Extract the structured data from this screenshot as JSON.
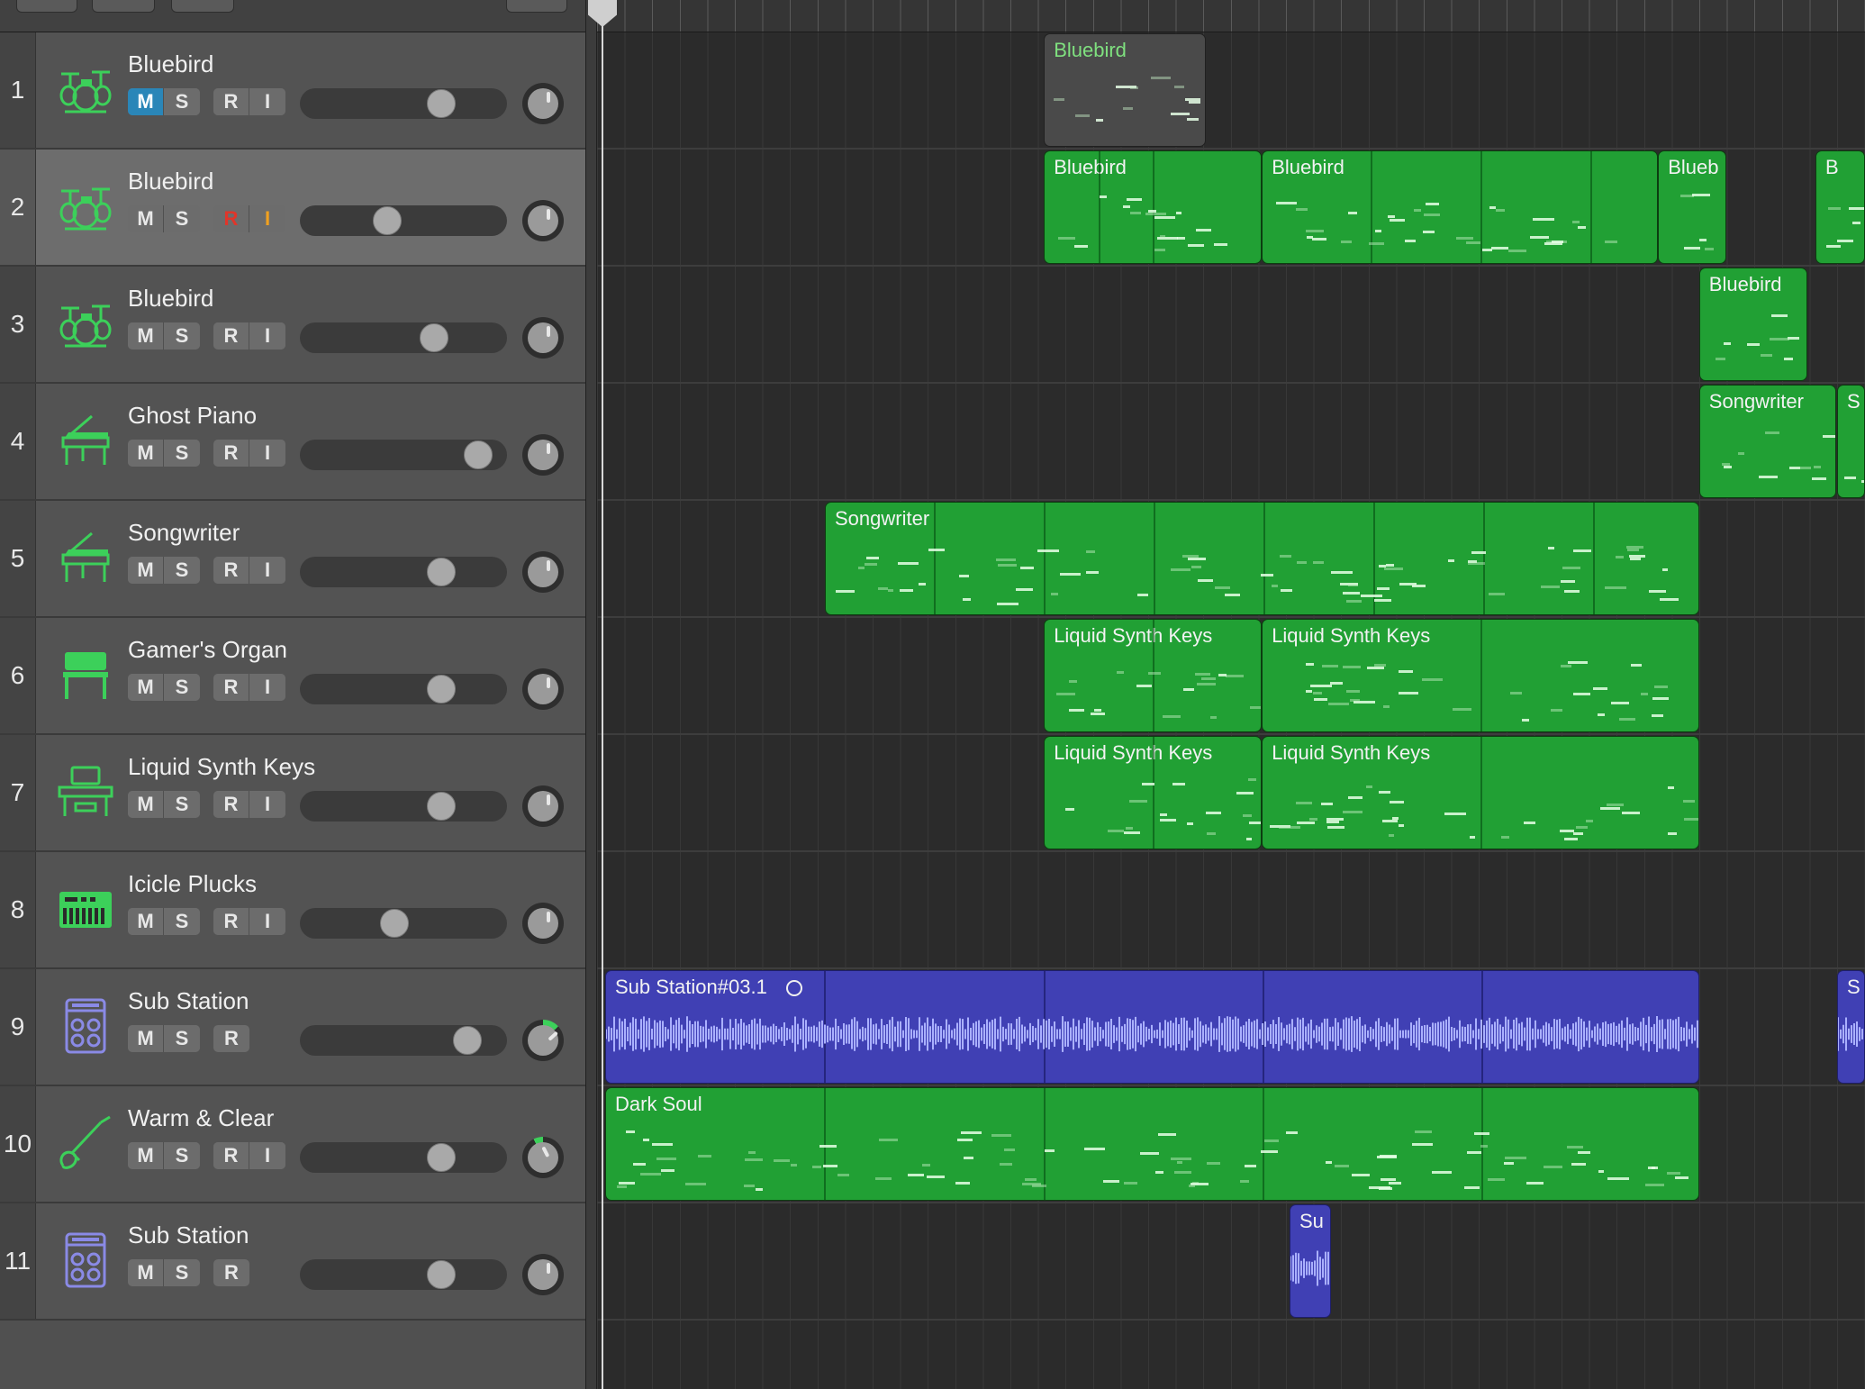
{
  "tracks": [
    {
      "num": "1",
      "name": "Bluebird",
      "icon": "drum-kit-icon",
      "mute": true,
      "solo": false,
      "rec": false,
      "input": false,
      "has_input": true,
      "volume": 0.71,
      "pan_color": "#e8e8e8",
      "pan": 0
    },
    {
      "num": "2",
      "name": "Bluebird",
      "icon": "drum-kit-icon",
      "mute": false,
      "solo": false,
      "rec": true,
      "input": true,
      "has_input": true,
      "volume": 0.41,
      "pan_color": "#e8e8e8",
      "pan": 0,
      "selected": true
    },
    {
      "num": "3",
      "name": "Bluebird",
      "icon": "drum-kit-icon",
      "mute": false,
      "solo": false,
      "rec": false,
      "input": false,
      "has_input": true,
      "volume": 0.67,
      "pan_color": "#e8e8e8",
      "pan": 0
    },
    {
      "num": "4",
      "name": "Ghost Piano",
      "icon": "grand-piano-icon",
      "mute": false,
      "solo": false,
      "rec": false,
      "input": false,
      "has_input": true,
      "volume": 0.92,
      "pan_color": "#e8e8e8",
      "pan": 0
    },
    {
      "num": "5",
      "name": "Songwriter",
      "icon": "grand-piano-icon",
      "mute": false,
      "solo": false,
      "rec": false,
      "input": false,
      "has_input": true,
      "volume": 0.71,
      "pan_color": "#e8e8e8",
      "pan": 0
    },
    {
      "num": "6",
      "name": "Gamer's Organ",
      "icon": "organ-icon",
      "mute": false,
      "solo": false,
      "rec": false,
      "input": false,
      "has_input": true,
      "volume": 0.71,
      "pan_color": "#e8e8e8",
      "pan": 0
    },
    {
      "num": "7",
      "name": "Liquid Synth Keys",
      "icon": "synth-workstation-icon",
      "mute": false,
      "solo": false,
      "rec": false,
      "input": false,
      "has_input": true,
      "volume": 0.71,
      "pan_color": "#e8e8e8",
      "pan": 0
    },
    {
      "num": "8",
      "name": "Icicle Plucks",
      "icon": "keyboard-synth-icon",
      "mute": false,
      "solo": false,
      "rec": false,
      "input": false,
      "has_input": true,
      "volume": 0.45,
      "pan_color": "#e8e8e8",
      "pan": 0
    },
    {
      "num": "9",
      "name": "Sub Station",
      "icon": "amp-cabinet-icon",
      "mute": false,
      "solo": false,
      "rec": false,
      "input": false,
      "has_input": false,
      "volume": 0.86,
      "pan_color": "#3cd05a",
      "pan": 0.35
    },
    {
      "num": "10",
      "name": "Warm & Clear",
      "icon": "bass-guitar-icon",
      "mute": false,
      "solo": false,
      "rec": false,
      "input": false,
      "has_input": true,
      "volume": 0.71,
      "pan_color": "#3cd05a",
      "pan": -0.2
    },
    {
      "num": "11",
      "name": "Sub Station",
      "icon": "amp-cabinet-icon",
      "mute": false,
      "solo": false,
      "rec": false,
      "input": false,
      "has_input": false,
      "volume": 0.71,
      "pan_color": "#e8e8e8",
      "pan": 0
    }
  ],
  "buttons": {
    "mute": "M",
    "solo": "S",
    "rec": "R",
    "input": "I"
  },
  "regions": [
    {
      "track": 1,
      "name": "Bluebird",
      "kind": "ghost",
      "start": 12.18,
      "len": 4.5,
      "seps": []
    },
    {
      "track": 2,
      "name": "Bluebird",
      "kind": "midi",
      "start": 12.18,
      "len": 6.05,
      "seps": [
        1.5,
        3.0
      ]
    },
    {
      "track": 2,
      "name": "Bluebird",
      "kind": "midi",
      "start": 18.23,
      "len": 11.0,
      "seps": [
        3.0,
        6.05,
        9.1
      ]
    },
    {
      "track": 2,
      "name": "Blueb",
      "kind": "midi",
      "start": 29.23,
      "len": 1.9,
      "seps": []
    },
    {
      "track": 2,
      "name": "B",
      "kind": "midi",
      "start": 33.6,
      "len": 2.0,
      "seps": []
    },
    {
      "track": 3,
      "name": "Bluebird",
      "kind": "midi",
      "start": 30.37,
      "len": 3.0,
      "seps": []
    },
    {
      "track": 4,
      "name": "Songwriter",
      "kind": "midi",
      "start": 30.37,
      "len": 3.8,
      "seps": []
    },
    {
      "track": 4,
      "name": "S",
      "kind": "midi",
      "start": 34.2,
      "len": 1.5,
      "seps": []
    },
    {
      "track": 5,
      "name": "Songwriter",
      "kind": "midi",
      "start": 6.1,
      "len": 24.27,
      "seps": [
        3.0,
        6.05,
        9.1,
        12.15,
        15.2,
        18.25,
        21.3
      ]
    },
    {
      "track": 6,
      "name": "Liquid Synth Keys",
      "kind": "midi",
      "start": 12.18,
      "len": 6.05,
      "seps": [
        3.0
      ]
    },
    {
      "track": 6,
      "name": "Liquid Synth Keys",
      "kind": "midi",
      "start": 18.23,
      "len": 12.14,
      "seps": [
        6.05
      ]
    },
    {
      "track": 7,
      "name": "Liquid Synth Keys",
      "kind": "midi",
      "start": 12.18,
      "len": 6.05,
      "seps": [
        3.0
      ]
    },
    {
      "track": 7,
      "name": "Liquid Synth Keys",
      "kind": "midi",
      "start": 18.23,
      "len": 12.14,
      "seps": [
        6.05
      ]
    },
    {
      "track": 9,
      "name": "Sub Station#03.1",
      "kind": "audio",
      "start": 0.0,
      "len": 30.37,
      "seps": [
        6.05,
        12.15,
        18.23,
        24.3
      ],
      "loop_icon": true
    },
    {
      "track": 9,
      "name": "S",
      "kind": "audio",
      "start": 34.2,
      "len": 1.5,
      "seps": []
    },
    {
      "track": 10,
      "name": "Dark Soul",
      "kind": "midi",
      "start": 0.0,
      "len": 30.37,
      "seps": [
        6.05,
        12.15,
        18.23,
        24.3
      ]
    },
    {
      "track": 11,
      "name": "Su",
      "kind": "audio",
      "start": 19.0,
      "len": 1.15,
      "seps": []
    }
  ],
  "colors": {
    "midi": "#21a034",
    "audio": "#4040b4",
    "icon_green": "#3cd05a",
    "icon_purple": "#8a8ae6"
  }
}
